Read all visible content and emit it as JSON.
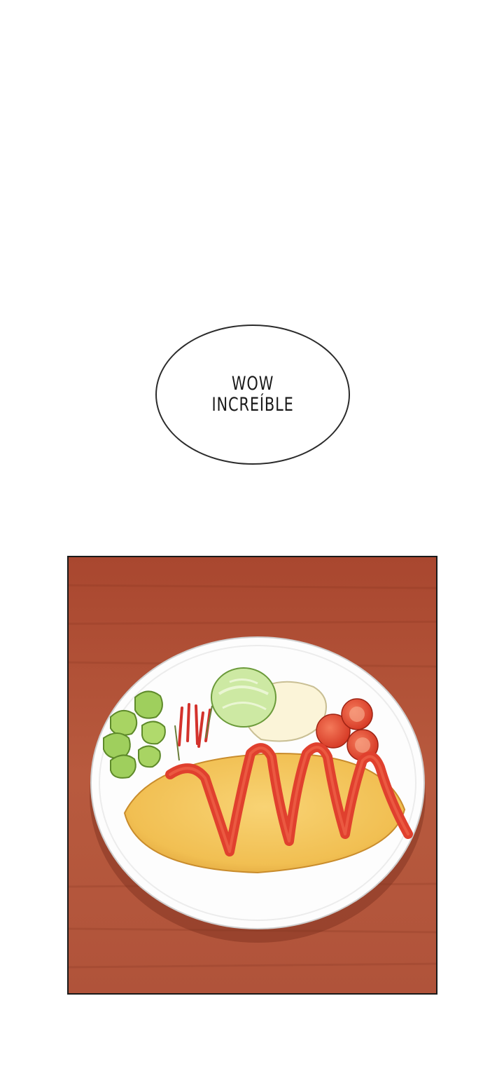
{
  "speech_bubble": {
    "line1": "WOW",
    "line2": "INCREÍBLE"
  },
  "panel": {
    "description_icon": "omelette-rice-plate-icon",
    "colors": {
      "table": "#b5563c",
      "plate": "#fdfdfd",
      "omelette": "#f3c25a",
      "ketchup": "#e0402e",
      "lettuce": "#b8dc8c",
      "tomato": "#e8442f"
    }
  }
}
